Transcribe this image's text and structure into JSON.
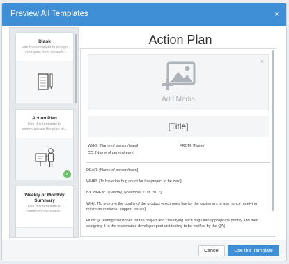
{
  "dialog": {
    "title": "Preview All Templates",
    "close_glyph": "×",
    "accent_color": "#3f8fd6"
  },
  "sidebar": {
    "cards": [
      {
        "title": "Blank",
        "description": "Use this template to design your post from scratch.",
        "icon": "notepad-pencil-icon"
      },
      {
        "title": "Action Plan",
        "description": "Use this template to communicate the plan of...",
        "icon": "presenter-icon",
        "selected": true
      },
      {
        "title": "Weekly or Monthly Summary",
        "description": "Use this template to communicate status...",
        "icon": ""
      }
    ]
  },
  "preview": {
    "heading": "Action Plan",
    "media_label": "Add Media",
    "media_close": "×",
    "title_placeholder": "[Title]",
    "who": "WHO: [Name of person/team]",
    "from": "FROM: [Name]",
    "cc": "CC: [Name of person/team]",
    "dear": "DEAR: [Name of person/team]",
    "what": "WHAT: [To have the bug count for the project to be zero]",
    "by_when": "BY WHEN: [Tuesday, November 21st, 2017]",
    "why": "WHY: [To improve the quality of the product which goes live for the customers to use hence receiving minimum customer support issues]",
    "how": "HOW: [Creating milestones for the project and classifying each bugs into appropriate priority and then assigning it to the responsible developer post unit testing to be verified by the QA]"
  },
  "footer": {
    "cancel_label": "Cancel",
    "use_label": "Use this Template"
  }
}
